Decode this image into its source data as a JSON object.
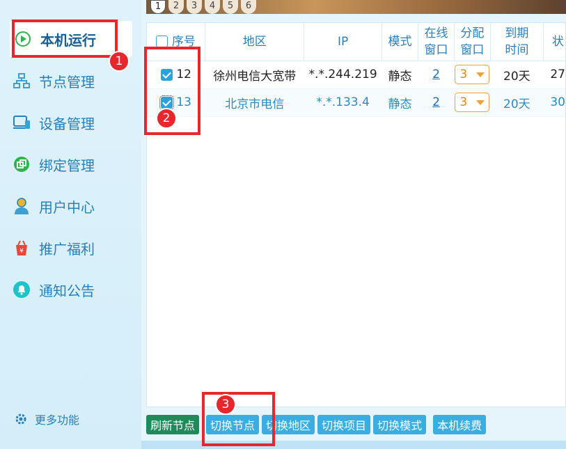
{
  "sidebar": {
    "items": [
      {
        "label": "本机运行",
        "icon": "play-icon"
      },
      {
        "label": "节点管理",
        "icon": "network-icon"
      },
      {
        "label": "设备管理",
        "icon": "device-icon"
      },
      {
        "label": "绑定管理",
        "icon": "bind-icon"
      },
      {
        "label": "用户中心",
        "icon": "user-icon"
      },
      {
        "label": "推广福利",
        "icon": "gift-icon"
      },
      {
        "label": "通知公告",
        "icon": "bell-icon"
      }
    ],
    "more": {
      "label": "更多功能",
      "icon": "gear-icon"
    }
  },
  "pagination": [
    "1",
    "2",
    "3",
    "4",
    "5",
    "6"
  ],
  "table": {
    "headers": {
      "index": "序号",
      "region": "地区",
      "ip": "IP",
      "mode": "模式",
      "online_1": "在线",
      "online_2": "窗口",
      "alloc_1": "分配",
      "alloc_2": "窗口",
      "expire_1": "到期",
      "expire_2": "时间",
      "status": "状"
    },
    "rows": [
      {
        "index": "12",
        "region": "徐州电信大宽带",
        "ip": "*.*.244.219",
        "mode": "静态",
        "online": "2",
        "alloc": "3",
        "expire": "20天",
        "status": "27"
      },
      {
        "index": "13",
        "region": "北京市电信",
        "ip": "*.*.133.4",
        "mode": "静态",
        "online": "2",
        "alloc": "3",
        "expire": "20天",
        "status": "30"
      }
    ]
  },
  "buttons": {
    "refresh": "刷新节点",
    "switch_node": "切换节点",
    "switch_region": "切换地区",
    "switch_project": "切换项目",
    "switch_mode": "切换模式",
    "renew": "本机续费"
  },
  "annotations": [
    "1",
    "2",
    "3"
  ],
  "colors": {
    "accent": "#2a7fb8",
    "highlight": "#e8262b",
    "select": "#f0a030"
  }
}
